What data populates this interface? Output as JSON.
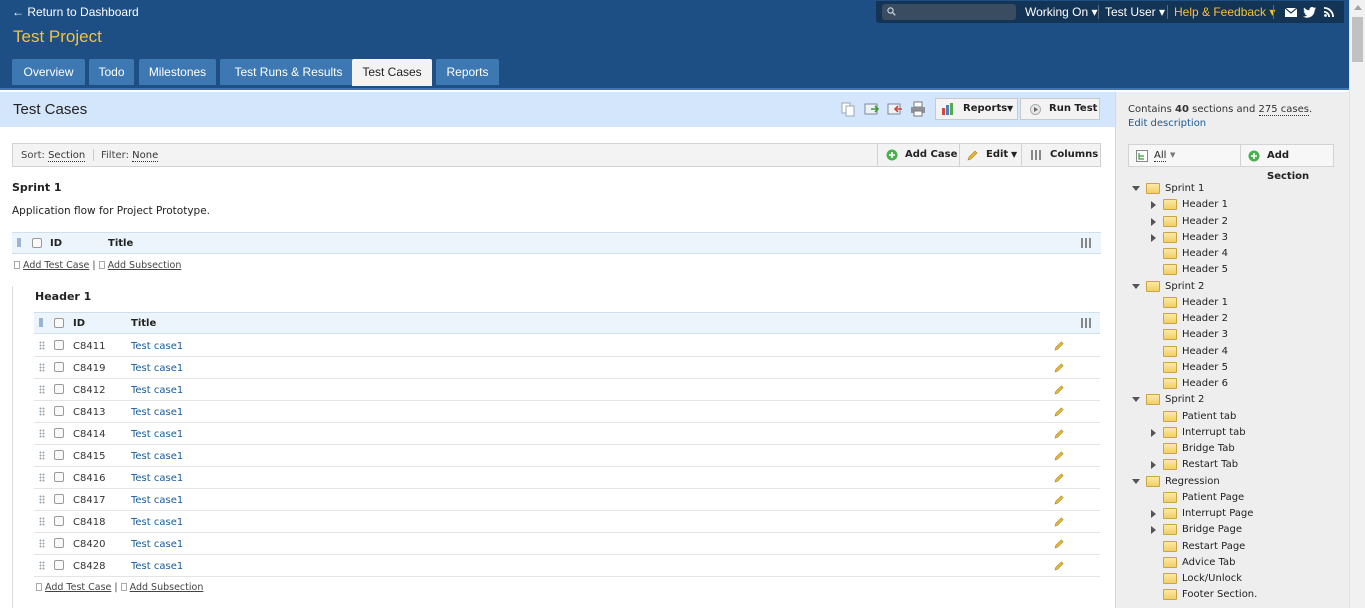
{
  "header": {
    "back_link": "← Return to Dashboard",
    "project_title": "Test Project",
    "working_on": "Working On ▾",
    "user": "Test User ▾",
    "help": "Help & Feedback ▾"
  },
  "tabs": [
    {
      "label": "Overview"
    },
    {
      "label": "Todo"
    },
    {
      "label": "Milestones"
    },
    {
      "label": "Test Runs & Results"
    },
    {
      "label": "Test Cases"
    },
    {
      "label": "Reports"
    }
  ],
  "page": {
    "title": "Test Cases",
    "reports_label": "Reports",
    "run_test_label": "Run Test"
  },
  "toolbar": {
    "sort_label": "Sort:",
    "sort_value": "Section",
    "filter_label": "Filter:",
    "filter_value": "None",
    "add_case": "Add Case",
    "edit": "Edit",
    "columns": "Columns"
  },
  "section": {
    "name": "Sprint 1",
    "description": "Application flow for Project Prototype.",
    "col_id": "ID",
    "col_title": "Title",
    "add_test_case": "Add Test Case",
    "add_subsection": "Add Subsection"
  },
  "subsection": {
    "name": "Header 1",
    "col_id": "ID",
    "col_title": "Title",
    "rows": [
      {
        "id": "C8411",
        "title": "Test case1"
      },
      {
        "id": "C8419",
        "title": "Test case1"
      },
      {
        "id": "C8412",
        "title": "Test case1"
      },
      {
        "id": "C8413",
        "title": "Test case1"
      },
      {
        "id": "C8414",
        "title": "Test case1"
      },
      {
        "id": "C8415",
        "title": "Test case1"
      },
      {
        "id": "C8416",
        "title": "Test case1"
      },
      {
        "id": "C8417",
        "title": "Test case1"
      },
      {
        "id": "C8418",
        "title": "Test case1"
      },
      {
        "id": "C8420",
        "title": "Test case1"
      },
      {
        "id": "C8428",
        "title": "Test case1"
      }
    ],
    "add_test_case": "Add Test Case",
    "add_subsection": "Add Subsection"
  },
  "sidebar": {
    "contains_prefix": "Contains",
    "sections_count": "40",
    "sections_word": "sections and",
    "cases_count": "275 cases",
    "edit_description": "Edit description",
    "filter_label": "All",
    "add_section": "Add Section",
    "tree": [
      {
        "label": "Sprint 1",
        "level": 0,
        "state": "open"
      },
      {
        "label": "Header 1",
        "level": 1,
        "state": "closed"
      },
      {
        "label": "Header 2",
        "level": 1,
        "state": "closed"
      },
      {
        "label": "Header 3",
        "level": 1,
        "state": "closed"
      },
      {
        "label": "Header 4",
        "level": 1,
        "state": "none"
      },
      {
        "label": "Header 5",
        "level": 1,
        "state": "none"
      },
      {
        "label": "Sprint 2",
        "level": 0,
        "state": "open"
      },
      {
        "label": "Header 1",
        "level": 1,
        "state": "none"
      },
      {
        "label": "Header 2",
        "level": 1,
        "state": "none"
      },
      {
        "label": "Header 3",
        "level": 1,
        "state": "none"
      },
      {
        "label": "Header 4",
        "level": 1,
        "state": "none"
      },
      {
        "label": "Header 5",
        "level": 1,
        "state": "none"
      },
      {
        "label": "Header 6",
        "level": 1,
        "state": "none"
      },
      {
        "label": "Sprint 2",
        "level": 0,
        "state": "open"
      },
      {
        "label": "Patient tab",
        "level": 1,
        "state": "none"
      },
      {
        "label": "Interrupt tab",
        "level": 1,
        "state": "closed"
      },
      {
        "label": "Bridge Tab",
        "level": 1,
        "state": "none"
      },
      {
        "label": "Restart Tab",
        "level": 1,
        "state": "closed"
      },
      {
        "label": "Regression",
        "level": 0,
        "state": "open"
      },
      {
        "label": "Patient Page",
        "level": 1,
        "state": "none"
      },
      {
        "label": "Interrupt Page",
        "level": 1,
        "state": "closed"
      },
      {
        "label": "Bridge Page",
        "level": 1,
        "state": "closed"
      },
      {
        "label": "Restart Page",
        "level": 1,
        "state": "none"
      },
      {
        "label": "Advice Tab",
        "level": 1,
        "state": "none"
      },
      {
        "label": "Lock/Unlock",
        "level": 1,
        "state": "none"
      },
      {
        "label": "Footer Section.",
        "level": 1,
        "state": "none"
      }
    ]
  }
}
